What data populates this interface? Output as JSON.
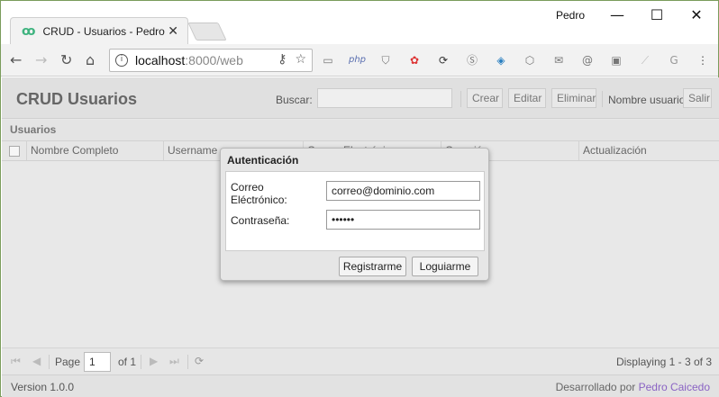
{
  "browser": {
    "tab_title": "CRUD - Usuarios - Pedro",
    "profile_name": "Pedro",
    "url_host": "localhost",
    "url_rest": ":8000/web"
  },
  "header": {
    "title": "CRUD Usuarios",
    "search_label": "Buscar:",
    "search_value": "",
    "create_label": "Crear",
    "edit_label": "Editar",
    "delete_label": "Eliminar",
    "user_label": "Nombre usuario",
    "logout_label": "Salir"
  },
  "panel": {
    "title": "Usuarios",
    "columns": [
      "Nombre Completo",
      "Username",
      "Correo Electrónico",
      "Creación",
      "Actualización"
    ]
  },
  "pager": {
    "page_label": "Page",
    "page_value": "1",
    "of_label": "of 1",
    "display_text": "Displaying 1 - 3 of 3"
  },
  "footer": {
    "version": "Version 1.0.0",
    "dev_prefix": "Desarrollado por ",
    "dev_name": "Pedro Caicedo"
  },
  "modal": {
    "title": "Autenticación",
    "email_label_line1": "Correo",
    "email_label_line2": "Eléctrónico:",
    "email_value": "correo@dominio.com",
    "password_label": "Contraseña:",
    "password_value": "••••••",
    "register_label": "Registrarme",
    "login_label": "Loguiarme"
  },
  "colors": {
    "link_purple": "#8a63c4",
    "favicon_green": "#3fb37f"
  }
}
